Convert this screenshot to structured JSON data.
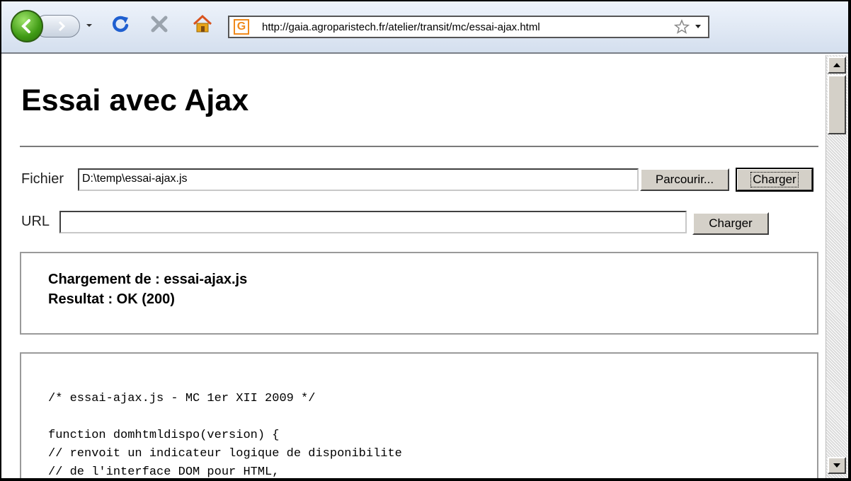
{
  "browser": {
    "address_url": "http://gaia.agroparistech.fr/atelier/transit/mc/essai-ajax.html",
    "site_icon_letter": "G",
    "icons": [
      "back-arrow-icon",
      "forward-arrow-icon",
      "chevron-down-icon",
      "refresh-icon",
      "stop-icon",
      "home-icon",
      "site-favicon",
      "star-icon"
    ]
  },
  "page": {
    "title": "Essai avec Ajax"
  },
  "file_row": {
    "label": "Fichier",
    "value": "D:\\temp\\essai-ajax.js",
    "browse_label": "Parcourir...",
    "load_label": "Charger"
  },
  "url_row": {
    "label": "URL",
    "value": "",
    "load_label": "Charger"
  },
  "status": {
    "line1": "Chargement de : essai-ajax.js",
    "line2": "Resultat : OK (200)"
  },
  "code": {
    "lines": [
      "/* essai-ajax.js - MC 1er XII 2009 */",
      "",
      "function domhtmldispo(version) {",
      "// renvoit un indicateur logique de disponibilite",
      "// de l'interface DOM pour HTML,"
    ]
  },
  "colors": {
    "back_button": "#3f9a14",
    "refresh": "#1f5fd0",
    "stop": "#9aa3ad",
    "home": "#e8a317",
    "site_icon": "#f08a1c"
  }
}
